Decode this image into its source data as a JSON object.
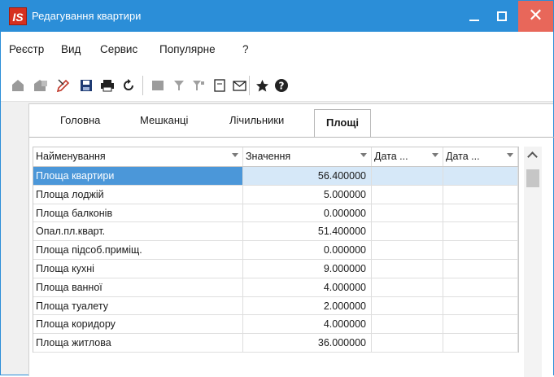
{
  "window": {
    "title": "Редагування квартири",
    "app_icon_text": "IS",
    "close_glyph": "✕"
  },
  "menu": {
    "items": [
      "Реєстр",
      "Вид",
      "Сервис",
      "Популярне",
      "?"
    ]
  },
  "toolbar": {
    "icons": [
      "add-icon",
      "copy-icon",
      "edit-icon",
      "save-icon",
      "print-icon",
      "refresh-icon",
      "table-view-icon",
      "filter-icon",
      "filter-clear-icon",
      "document-icon",
      "mail-icon",
      "star-icon",
      "help-icon"
    ]
  },
  "tabs": {
    "items": [
      "Головна",
      "Мешканці",
      "Лічильники",
      "Площі"
    ],
    "active": "Площі"
  },
  "grid": {
    "columns": [
      "Найменування",
      "Значення",
      "Дата ...",
      "Дата ..."
    ],
    "rows": [
      {
        "name": "Площа квартири",
        "value": "56.400000"
      },
      {
        "name": "Площа лоджій",
        "value": "5.000000"
      },
      {
        "name": "Площа балконів",
        "value": "0.000000"
      },
      {
        "name": "Опал.пл.кварт.",
        "value": "51.400000"
      },
      {
        "name": "Площа підсоб.приміщ.",
        "value": "0.000000"
      },
      {
        "name": "Площа кухні",
        "value": "9.000000"
      },
      {
        "name": "Площа ванної",
        "value": "4.000000"
      },
      {
        "name": "Площа туалету",
        "value": "2.000000"
      },
      {
        "name": "Площа коридору",
        "value": "4.000000"
      },
      {
        "name": "Площа житлова",
        "value": "36.000000"
      }
    ],
    "selected_row": "Площа квартири"
  },
  "colors": {
    "titlebar": "#2b8ed8",
    "close_button": "#e8675a",
    "selection": "#4b97d9"
  }
}
